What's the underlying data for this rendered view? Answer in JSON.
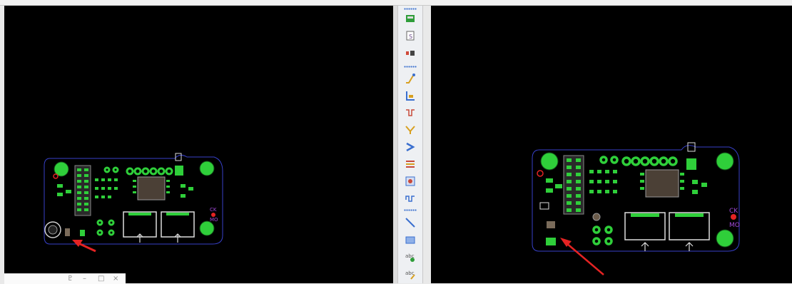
{
  "window": {
    "controls": {
      "pin": "♇",
      "minimize": "–",
      "maximize": "□",
      "close": "×"
    }
  },
  "toolbar": {
    "groups": [
      {
        "items": [
          "place-component-icon",
          "schematic-symbol-icon",
          "place-part-icon"
        ]
      },
      {
        "items": [
          "route-trace-icon",
          "align-icon",
          "length-tune-icon",
          "dimension-icon",
          "push-shove-icon",
          "layer-stack-icon",
          "design-rule-icon",
          "meander-icon"
        ]
      },
      {
        "items": [
          "draw-line-icon",
          "draw-rect-icon",
          "add-text-icon",
          "edit-text-icon"
        ]
      }
    ]
  },
  "colors": {
    "canvas": "#000000",
    "pad": "#2fcf3a",
    "outline": "#3740c8",
    "annotation_arrow": "#e52323",
    "silkscreen": "#e8e8e8"
  },
  "views": [
    {
      "name": "left",
      "outline_labels": [
        "CK",
        "MO"
      ]
    },
    {
      "name": "right",
      "outline_labels": [
        "CK",
        "MO"
      ]
    }
  ]
}
